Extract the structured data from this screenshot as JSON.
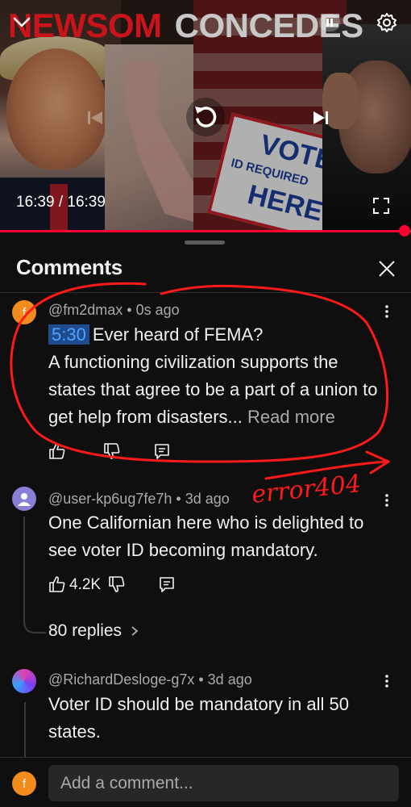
{
  "player": {
    "headline_red": "NEWSOM",
    "headline_gray": "CONCEDES",
    "time_current": "16:39",
    "time_separator": " / ",
    "time_total": "16:39",
    "progress_fraction": 1.0,
    "sign_top": "VOTE",
    "sign_middle": "ID REQUIRED",
    "sign_bottom": "HERE",
    "icons": [
      "chevron-down-icon",
      "pause-icon",
      "settings-icon",
      "previous-icon",
      "replay-icon",
      "next-icon",
      "fullscreen-icon"
    ],
    "accent_color": "#ff0033"
  },
  "sheet": {
    "title": "Comments",
    "close_icon": "close-icon"
  },
  "comments": [
    {
      "avatar_letter": "f",
      "avatar_color": "#f28c1d",
      "author": "@fm2dmax",
      "age": "0s ago",
      "timestamp": "5:30",
      "text_first": "Ever heard of FEMA?",
      "text_rest": "A functioning civilization supports the states that agree to be a part of a union to get help from disasters...",
      "read_more": "Read more",
      "likes": ""
    },
    {
      "avatar_color": "#8a7fd6",
      "author": "@user-kp6ug7fe7h",
      "age": "3d ago",
      "text": "One Californian here who is delighted to see voter ID becoming mandatory.",
      "likes": "4.2K",
      "replies": "80 replies"
    },
    {
      "avatar_color": "#e040a8",
      "author": "@RichardDesloge-g7x",
      "age": "3d ago",
      "text": "Voter ID should be mandatory in all 50 states."
    }
  ],
  "annotation": {
    "text": "error404",
    "color": "#ff1a1a"
  },
  "composer": {
    "avatar_letter": "f",
    "avatar_color": "#f28c1d",
    "placeholder": "Add a comment..."
  }
}
